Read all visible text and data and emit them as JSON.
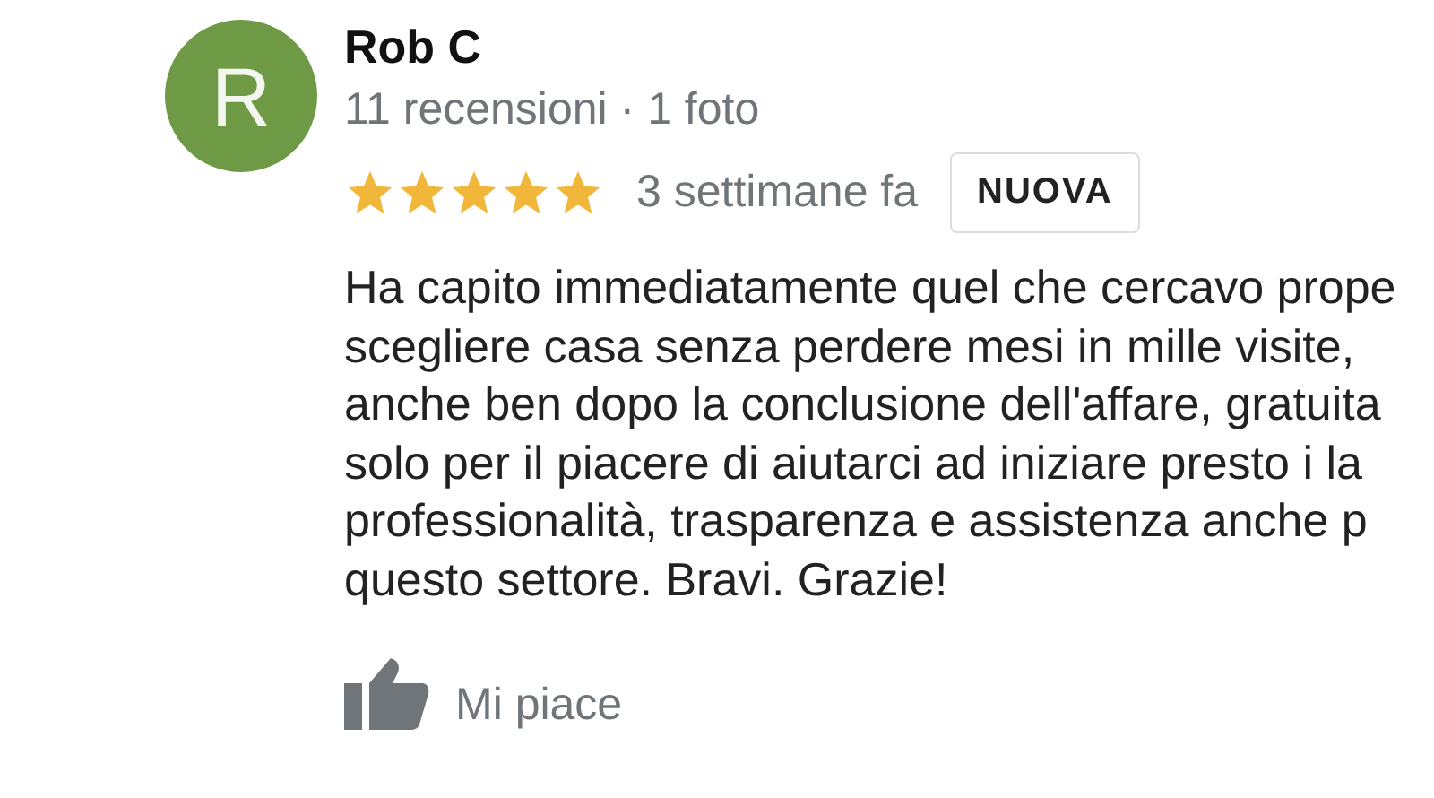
{
  "review": {
    "avatar_letter": "R",
    "author": "Rob C",
    "author_meta": "11 recensioni · 1 foto",
    "stars": 5,
    "time": "3 settimane fa",
    "badge": "NUOVA",
    "text_lines": [
      "Ha capito immediatamente quel che cercavo prope",
      "scegliere casa senza perdere mesi in mille visite,",
      "anche ben dopo la conclusione dell'affare, gratuita",
      "solo per il piacere di aiutarci ad iniziare presto i la",
      "professionalità, trasparenza e assistenza anche p",
      "questo settore. Bravi. Grazie!"
    ],
    "like_label": "Mi piace"
  }
}
